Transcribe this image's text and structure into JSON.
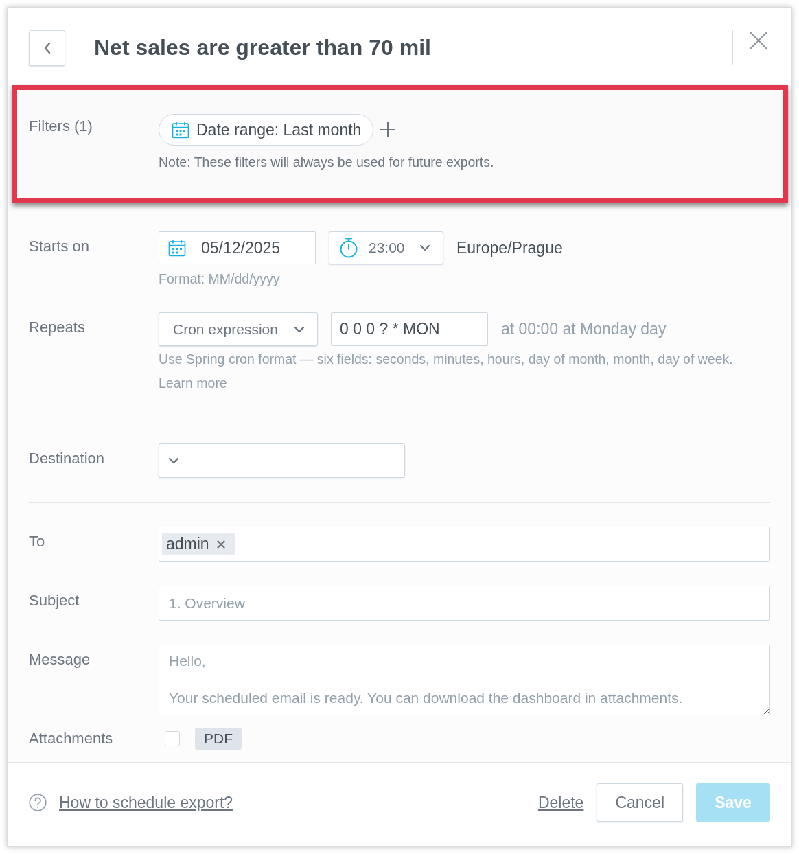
{
  "header": {
    "title": "Net sales are greater than 70 mil"
  },
  "filters": {
    "highlighted": true,
    "label": "Filters (1)",
    "chips": [
      {
        "label": "Date range: Last month"
      }
    ],
    "note": "Note: These filters will always be used for future exports."
  },
  "starts_on": {
    "label": "Starts on",
    "date": "05/12/2025",
    "time": "23:00",
    "timezone": "Europe/Prague",
    "hint": "Format: MM/dd/yyyy"
  },
  "repeats": {
    "label": "Repeats",
    "mode": "Cron expression",
    "cron": "0 0 0 ? * MON",
    "description": "at 00:00 at Monday day",
    "hint": "Use Spring cron format — six fields: seconds, minutes, hours, day of month, month, day of week.",
    "hint_link": "Learn more"
  },
  "destination": {
    "label": "Destination"
  },
  "to": {
    "label": "To",
    "recipients": [
      {
        "name": "admin"
      }
    ]
  },
  "subject": {
    "label": "Subject",
    "placeholder": "1. Overview"
  },
  "message": {
    "label": "Message",
    "placeholder": "Hello,\n\nYour scheduled email is ready. You can download the dashboard in attachments."
  },
  "attachments": {
    "label": "Attachments",
    "checked": false,
    "format": "PDF"
  },
  "footer": {
    "help_link": "How to schedule export?",
    "buttons": [
      {
        "label": "Delete",
        "kind": "link",
        "disabled": false
      },
      {
        "label": "Cancel",
        "kind": "secondary",
        "disabled": false
      },
      {
        "label": "Save",
        "kind": "primary",
        "disabled": true
      }
    ]
  }
}
